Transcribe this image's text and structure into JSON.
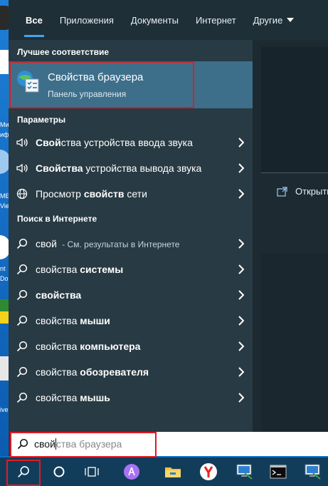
{
  "tabs": [
    {
      "label": "Все",
      "active": true
    },
    {
      "label": "Приложения"
    },
    {
      "label": "Документы"
    },
    {
      "label": "Интернет"
    },
    {
      "label": "Другие"
    }
  ],
  "sections": {
    "best_match": "Лучшее соответствие",
    "settings": "Параметры",
    "web": "Поиск в Интернете"
  },
  "best_match": {
    "title": "Свойства браузера",
    "subtitle": "Панель управления"
  },
  "settings_items": [
    {
      "bold": "Свой",
      "rest": "ства устройства ввода звука",
      "icon": "speaker-icon"
    },
    {
      "bold": "Свойства",
      "rest": " устройства вывода звука",
      "icon": "speaker-icon"
    },
    {
      "pre": "Просмотр ",
      "bold": "свойств",
      "rest": " сети",
      "icon": "globe-icon"
    }
  ],
  "web_items": [
    {
      "pre": "свой",
      "hint": " - См. результаты в Интернете"
    },
    {
      "pre": "свойства ",
      "bold": "системы"
    },
    {
      "pre": "свойства",
      "bold": ""
    },
    {
      "pre": "свойства ",
      "bold": "мыши"
    },
    {
      "pre": "свойства ",
      "bold": "компьютера"
    },
    {
      "pre": "свойства ",
      "bold": "обозревателя"
    },
    {
      "pre": "свойства ",
      "bold": "мышь"
    }
  ],
  "right_panel": {
    "open_label": "Открыть"
  },
  "search": {
    "typed": "свой",
    "suggestion": "ства браузера"
  },
  "desktop": {
    "labels": [
      "Ми",
      "иф",
      "МЕ",
      "Vie",
      "nt",
      "Do",
      "ive"
    ]
  },
  "taskbar": {
    "icons": [
      "search-icon",
      "cortana-icon",
      "task-view-icon",
      "alice-icon",
      "file-explorer-icon",
      "yandex-browser-icon",
      "network-app-icon",
      "terminal-icon",
      "network-app-icon-2"
    ]
  },
  "colors": {
    "accent": "#4aa3e8",
    "highlight_border": "#e01b24",
    "panel": "#283a43",
    "selected": "#3d6f8b"
  }
}
